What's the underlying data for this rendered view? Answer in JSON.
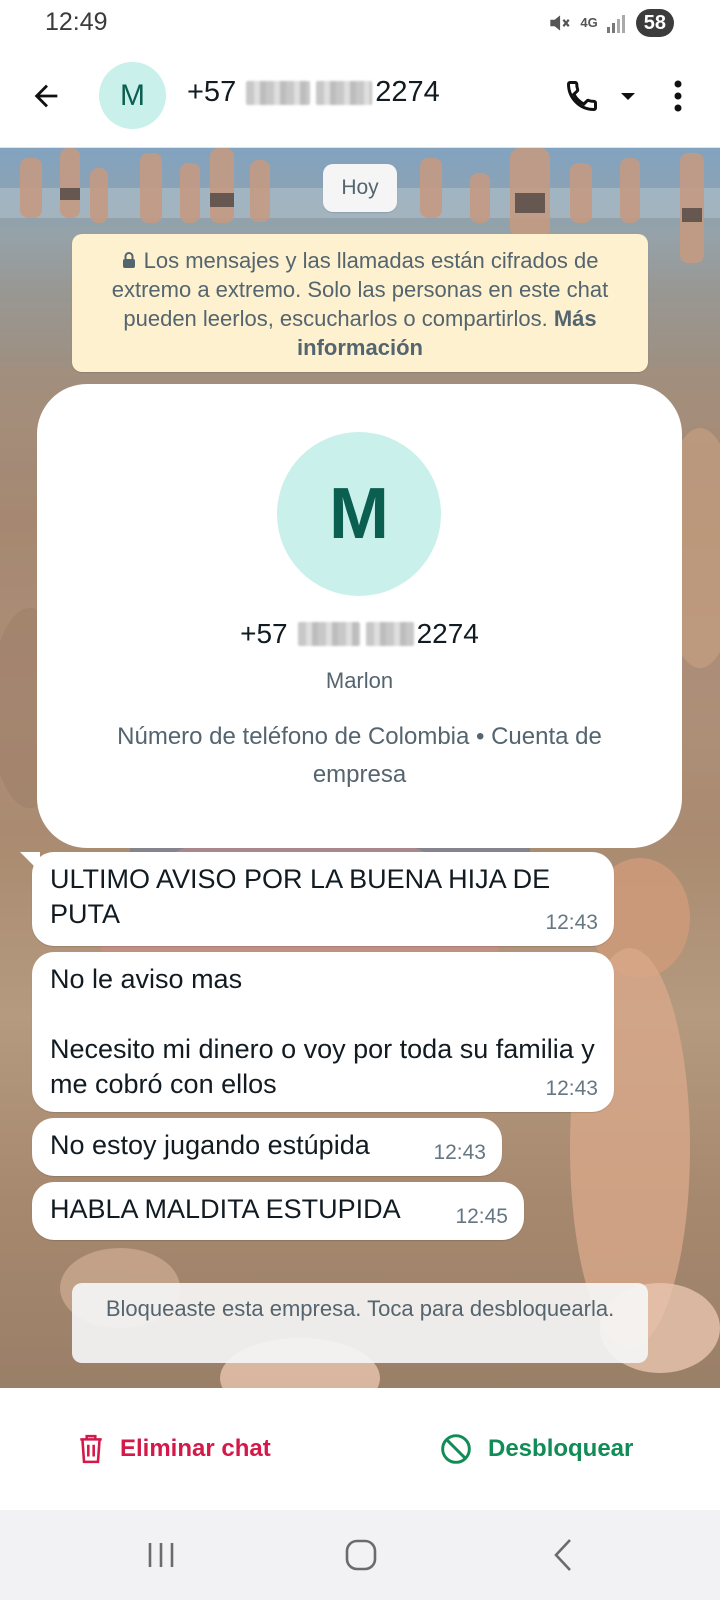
{
  "status_bar": {
    "time": "12:49",
    "network": "4G",
    "battery": "58"
  },
  "header": {
    "avatar_letter": "M",
    "phone_prefix": "+57",
    "phone_suffix": "2274"
  },
  "chat": {
    "date_label": "Hoy",
    "encryption_notice": "Los mensajes y las llamadas están cifrados de extremo a extremo. Solo las personas en este chat pueden leerlos, escucharlos o compartirlos.",
    "encryption_link": "Más información",
    "profile_card": {
      "avatar_letter": "M",
      "phone_prefix": "+57",
      "phone_suffix": "2274",
      "name": "Marlon",
      "description": "Número de teléfono de Colombia • Cuenta de empresa"
    },
    "messages": [
      {
        "text": "ULTIMO AVISO POR LA BUENA HIJA DE PUTA",
        "time": "12:43"
      },
      {
        "text": "No le aviso mas\n\nNecesito mi dinero o voy por toda su familia y me cobró con ellos",
        "time": "12:43"
      },
      {
        "text": "No estoy jugando estúpida",
        "time": "12:43"
      },
      {
        "text": "HABLA MALDITA ESTUPIDA",
        "time": "12:45"
      }
    ],
    "blocked_notice": "Bloqueaste esta empresa. Toca para desbloquearla."
  },
  "actions": {
    "delete_label": "Eliminar chat",
    "unblock_label": "Desbloquear"
  },
  "colors": {
    "accent_green": "#118c57",
    "delete_red": "#d4194a",
    "avatar_bg": "#c9f0eb",
    "notice_bg": "#fdf1cf"
  },
  "icons": [
    "back-arrow-icon",
    "phone-icon",
    "caret-down-icon",
    "more-vert-icon",
    "lock-icon",
    "trash-icon",
    "block-icon",
    "recent-apps-icon",
    "home-icon",
    "back-nav-icon",
    "mute-icon",
    "signal-icon"
  ]
}
